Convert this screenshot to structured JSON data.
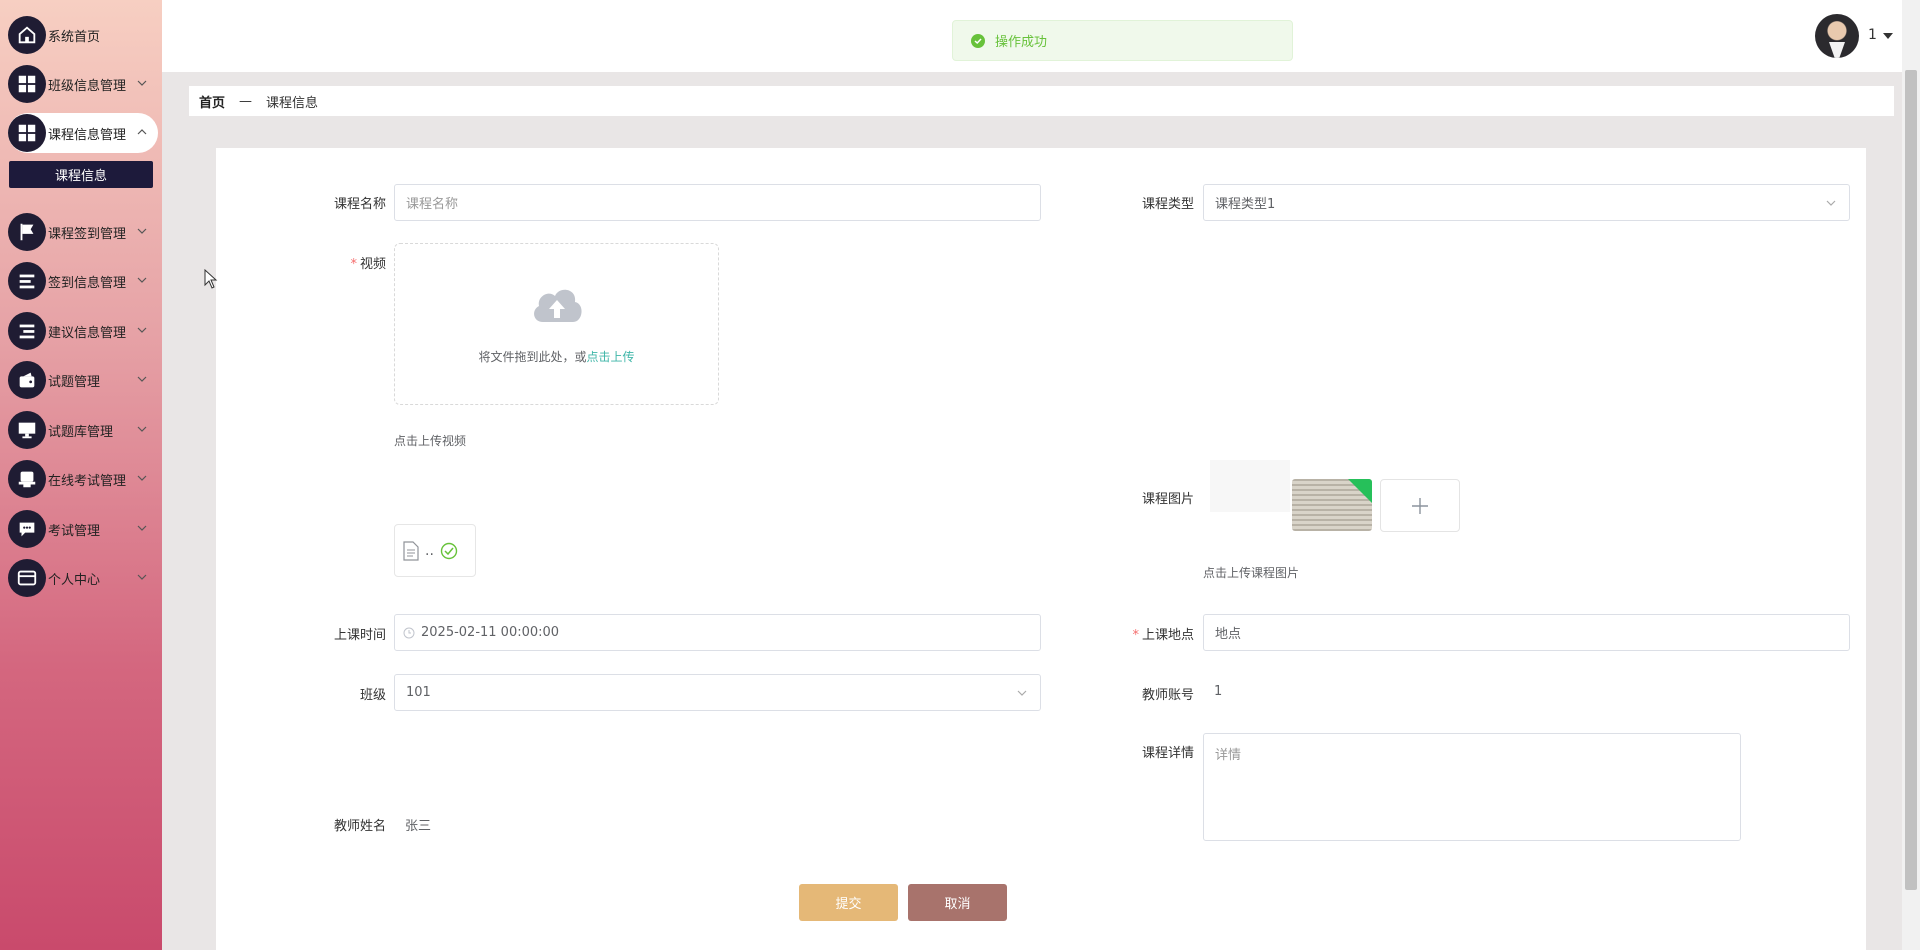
{
  "sidebar": {
    "items": [
      {
        "label": "系统首页",
        "icon": "home-icon",
        "has_caret": false
      },
      {
        "label": "班级信息管理",
        "icon": "grid-icon",
        "has_caret": true
      },
      {
        "label": "课程信息管理",
        "icon": "grid-icon",
        "has_caret": true,
        "expanded": true
      },
      {
        "label": "课程签到管理",
        "icon": "flag-icon",
        "has_caret": true
      },
      {
        "label": "签到信息管理",
        "icon": "list-icon",
        "has_caret": true
      },
      {
        "label": "建议信息管理",
        "icon": "list-icon",
        "has_caret": true
      },
      {
        "label": "试题管理",
        "icon": "wallet-icon",
        "has_caret": true
      },
      {
        "label": "试题库管理",
        "icon": "monitor-icon",
        "has_caret": true
      },
      {
        "label": "在线考试管理",
        "icon": "printer-icon",
        "has_caret": true
      },
      {
        "label": "考试管理",
        "icon": "chat-icon",
        "has_caret": true
      },
      {
        "label": "个人中心",
        "icon": "card-icon",
        "has_caret": true
      }
    ],
    "submenu_active": "课程信息"
  },
  "topbar": {
    "toast": "操作成功",
    "user_name": "1"
  },
  "breadcrumb": {
    "home": "首页",
    "separator": "—",
    "current": "课程信息"
  },
  "form": {
    "course_name": {
      "label": "课程名称",
      "placeholder": "课程名称"
    },
    "course_type": {
      "label": "课程类型",
      "value": "课程类型1"
    },
    "video": {
      "label": "视频",
      "upload_text": "将文件拖到此处，或",
      "upload_link": "点击上传",
      "tip": "点击上传视频",
      "file_name": ".."
    },
    "course_image": {
      "label": "课程图片",
      "tip": "点击上传课程图片"
    },
    "class_time": {
      "label": "上课时间",
      "value": "2025-02-11 00:00:00"
    },
    "location": {
      "label": "上课地点",
      "placeholder": "地点"
    },
    "class": {
      "label": "班级",
      "value": "101"
    },
    "teacher_account": {
      "label": "教师账号",
      "value": "1"
    },
    "course_detail": {
      "label": "课程详情",
      "placeholder": "详情"
    },
    "teacher_name": {
      "label": "教师姓名",
      "value": "张三"
    },
    "submit_label": "提交",
    "cancel_label": "取消"
  },
  "colors": {
    "accent_dark": "#1f1c33",
    "toast_green": "#67c23a",
    "submit": "#e5b877",
    "cancel": "#a8736c",
    "required": "#f56c6c",
    "link": "#3fb6a8"
  }
}
